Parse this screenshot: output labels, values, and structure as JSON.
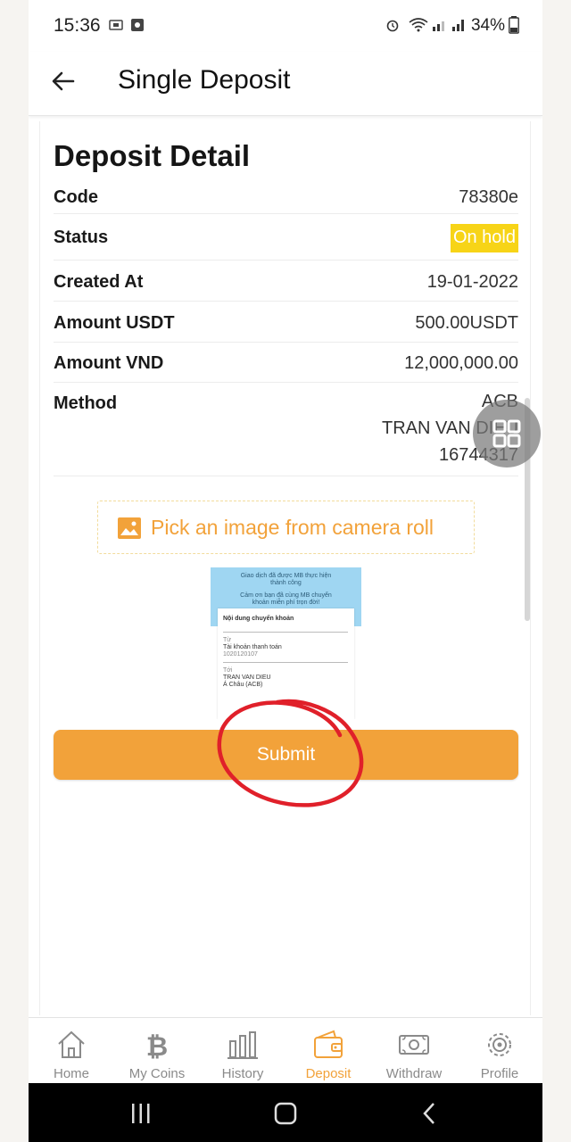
{
  "status_bar": {
    "time": "15:36",
    "battery": "34%"
  },
  "app_bar": {
    "title": "Single Deposit"
  },
  "detail": {
    "heading": "Deposit Detail",
    "code_label": "Code",
    "code_value": "78380e",
    "status_label": "Status",
    "status_value": "On hold",
    "created_label": "Created At",
    "created_value": "19-01-2022",
    "usdt_label": "Amount USDT",
    "usdt_value": "500.00USDT",
    "vnd_label": "Amount VND",
    "vnd_value": "12,000,000.00",
    "method_label": "Method",
    "method_bank": "ACB",
    "method_name": "TRAN VAN DIEU",
    "method_account": "16744317"
  },
  "pick_image": {
    "label": "Pick an image from camera roll"
  },
  "preview": {
    "line1": "Giao dịch đã được MB thực hiện",
    "line2": "thành công",
    "line3": "Cảm ơn bạn đã cùng MB chuyển",
    "line4": "khoản miễn phí trọn đời!",
    "section": "Nội dung chuyển khoản",
    "from_label": "Từ",
    "from_value": "Tài khoản thanh toán",
    "from_acct": "1020120107",
    "to_label": "Tới",
    "to_name": "TRAN VAN DIEU",
    "to_bank": "Á Châu (ACB)"
  },
  "submit_label": "Submit",
  "bottom_nav": {
    "items": [
      {
        "label": "Home",
        "icon": "home-icon"
      },
      {
        "label": "My Coins",
        "icon": "bitcoin-icon"
      },
      {
        "label": "History",
        "icon": "bar-chart-icon"
      },
      {
        "label": "Deposit",
        "icon": "wallet-icon"
      },
      {
        "label": "Withdraw",
        "icon": "cash-icon"
      },
      {
        "label": "Profile",
        "icon": "gear-icon"
      }
    ],
    "active_index": 3
  },
  "colors": {
    "accent": "#f2a23a",
    "status_badge": "#f7d417",
    "annotation": "#e0202a"
  }
}
